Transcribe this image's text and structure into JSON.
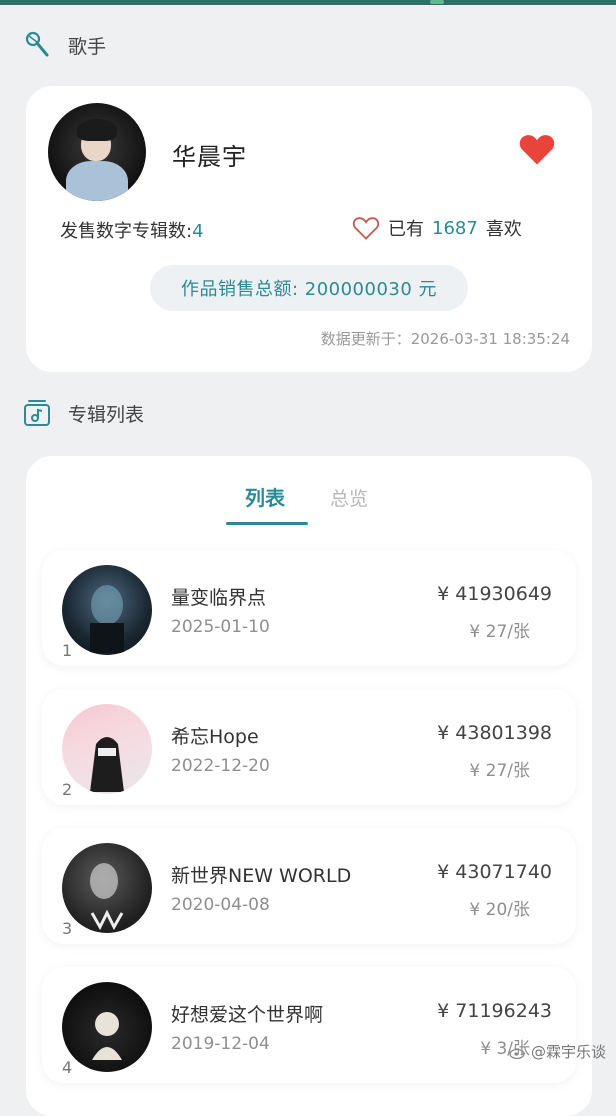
{
  "singer_section": {
    "label": "歌手"
  },
  "singer": {
    "name": "华晨宇",
    "albums_label": "发售数字专辑数:",
    "albums_count": "4",
    "likes_prefix": "已有",
    "likes_count": "1687",
    "likes_suffix": "喜欢",
    "sales_total": "作品销售总额: 200000030 元",
    "updated": "数据更新于：2026-03-31 18:35:24"
  },
  "album_section": {
    "label": "专辑列表"
  },
  "tabs": [
    {
      "label": "列表",
      "active": true
    },
    {
      "label": "总览",
      "active": false
    }
  ],
  "albums": [
    {
      "index": "1",
      "title": "量变临界点",
      "date": "2025-01-10",
      "total": "¥ 41930649",
      "price": "¥ 27/张"
    },
    {
      "index": "2",
      "title": "希忘Hope",
      "date": "2022-12-20",
      "total": "¥ 43801398",
      "price": "¥ 27/张"
    },
    {
      "index": "3",
      "title": "新世界NEW WORLD",
      "date": "2020-04-08",
      "total": "¥ 43071740",
      "price": "¥ 20/张"
    },
    {
      "index": "4",
      "title": "好想爱这个世界啊",
      "date": "2019-12-04",
      "total": "¥ 71196243",
      "price": "¥ 3/张"
    }
  ],
  "watermark": {
    "text": "@霖宇乐谈"
  },
  "colors": {
    "accent": "#2c8a96",
    "heart": "#e8443c",
    "background": "#eef0f2"
  },
  "icons": {
    "singer": "microphone-icon",
    "albums": "music-folder-icon",
    "liked": "heart-filled-icon",
    "like": "heart-outline-icon"
  }
}
